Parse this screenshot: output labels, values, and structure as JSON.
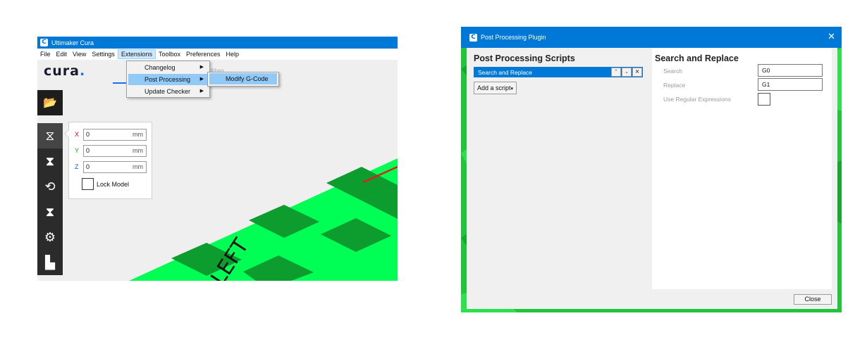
{
  "cura_window": {
    "title": "Ultimaker Cura",
    "logo_letter": "C",
    "menu": [
      "File",
      "Edit",
      "View",
      "Settings",
      "Extensions",
      "Toolbox",
      "Preferences",
      "Help"
    ],
    "active_menu": "Extensions",
    "brand": {
      "text": "cura",
      "dot": "."
    },
    "ghost_text": "lliban",
    "extensions_menu": [
      {
        "label": "Changelog",
        "has_submenu": true
      },
      {
        "label": "Post Processing",
        "has_submenu": true,
        "highlighted": true
      },
      {
        "label": "Update Checker",
        "has_submenu": true
      }
    ],
    "post_processing_submenu": [
      {
        "label": "Modify G-Code",
        "highlighted": true
      }
    ],
    "tools": [
      {
        "name": "open-file-icon",
        "glyph": "📂"
      },
      {
        "name": "move-tool-icon",
        "glyph": "⧖"
      },
      {
        "name": "scale-tool-icon",
        "glyph": "⧗"
      },
      {
        "name": "rotate-tool-icon",
        "glyph": "⟲"
      },
      {
        "name": "mirror-tool-icon",
        "glyph": "⧗"
      },
      {
        "name": "per-model-settings-icon",
        "glyph": "⚙"
      },
      {
        "name": "support-blocker-icon",
        "glyph": "▙"
      }
    ],
    "move_panel": {
      "x": {
        "label": "X",
        "value": "0",
        "unit": "mm"
      },
      "y": {
        "label": "Y",
        "value": "0",
        "unit": "mm"
      },
      "z": {
        "label": "Z",
        "value": "0",
        "unit": "mm"
      },
      "lock_label": "Lock Model"
    },
    "bed_text": "LEFT",
    "colors": {
      "titlebar": "#0078d7",
      "bed_light": "#00ff55",
      "bed_dark": "#0d9c2e",
      "bed_edge_red": "#e02020"
    }
  },
  "pp_window": {
    "title": "Post Processing Plugin",
    "logo_letter": "C",
    "close_glyph": "✕",
    "scripts_heading": "Post Processing Scripts",
    "scripts": [
      {
        "label": "Search and Replace",
        "selected": true
      }
    ],
    "script_buttons": {
      "up": "⌃",
      "down": "⌄",
      "remove": "✕"
    },
    "add_script_label": "Add a script",
    "add_script_arrow": "▾",
    "settings_heading": "Search and Replace",
    "settings": {
      "search": {
        "label": "Search",
        "value": "G0"
      },
      "replace": {
        "label": "Replace",
        "value": "G1"
      },
      "regex": {
        "label": "Use Regular Expressions",
        "checked": false
      }
    },
    "close_button": "Close",
    "colors": {
      "titlebar": "#0078d7",
      "selection": "#0078d7",
      "background_green": "#22c43c"
    }
  }
}
